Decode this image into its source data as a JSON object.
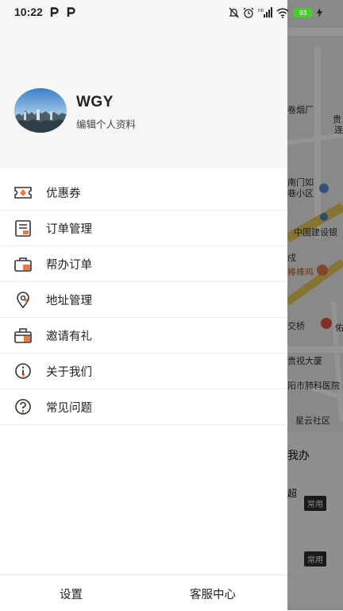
{
  "status_bar": {
    "time": "10:22",
    "battery": "93"
  },
  "map": {
    "labels": [
      "卷烟厂",
      "贵",
      "连",
      "南门如",
      "巷小区",
      "中国建设银",
      "戍",
      "棒棒鸡",
      "交桥",
      "佑",
      "贵视大厦",
      "阳市肺科医院",
      "星云社区",
      "我办",
      "超"
    ],
    "chip_label_1": "常用",
    "chip_label_2": "常用"
  },
  "profile": {
    "name": "WGY",
    "edit_label": "编辑个人资料"
  },
  "menu": {
    "items": [
      {
        "label": "优惠券",
        "icon": "coupon-icon"
      },
      {
        "label": "订单管理",
        "icon": "order-icon"
      },
      {
        "label": "帮办订单",
        "icon": "assist-order-icon"
      },
      {
        "label": "地址管理",
        "icon": "location-icon"
      },
      {
        "label": "邀请有礼",
        "icon": "gift-icon"
      },
      {
        "label": "关于我们",
        "icon": "info-icon"
      },
      {
        "label": "常见问题",
        "icon": "question-icon"
      }
    ]
  },
  "footer": {
    "settings": "设置",
    "service": "客服中心"
  },
  "colors": {
    "accent": "#f07a3a",
    "icon_stroke": "#333333",
    "header_bg": "#f6f6f6"
  }
}
